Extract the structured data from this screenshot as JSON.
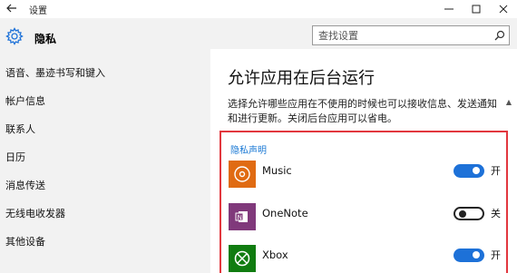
{
  "window": {
    "title": "设置",
    "back_icon": "arrow-left-icon",
    "controls": [
      "minimize-icon",
      "maximize-icon",
      "close-icon"
    ]
  },
  "sidebar": {
    "heading": "隐私",
    "heading_icon": "gear-icon",
    "items": [
      {
        "label": "语音、墨迹书写和键入"
      },
      {
        "label": "帐户信息"
      },
      {
        "label": "联系人"
      },
      {
        "label": "日历"
      },
      {
        "label": "消息传送"
      },
      {
        "label": "无线电收发器"
      },
      {
        "label": "其他设备"
      }
    ]
  },
  "search": {
    "placeholder": "查找设置",
    "icon": "search-icon"
  },
  "main": {
    "title": "允许应用在后台运行",
    "description": "选择允许哪些应用在不使用的时候也可以接收信息、发送通知和进行更新。关闭后台应用可以省电。",
    "privacy_link": "隐私声明",
    "apps": [
      {
        "name": "Music",
        "state": "开",
        "on": true,
        "color": "#e06b12",
        "icon": "music-disc-icon"
      },
      {
        "name": "OneNote",
        "state": "关",
        "on": false,
        "color": "#80397b",
        "icon": "onenote-icon"
      },
      {
        "name": "Xbox",
        "state": "开",
        "on": true,
        "color": "#107c10",
        "icon": "xbox-icon"
      }
    ]
  },
  "colors": {
    "accent": "#1d71d8",
    "highlight": "#e2373e",
    "link": "#1978d4"
  }
}
